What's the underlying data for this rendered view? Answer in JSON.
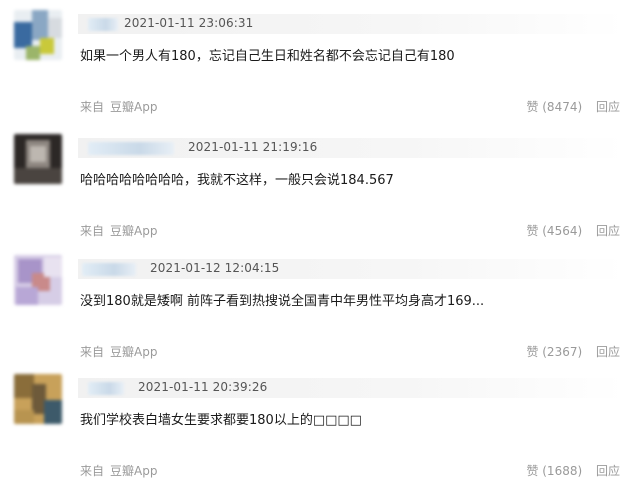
{
  "comments": [
    {
      "time": "2021-01-11 23:06:31",
      "content": "如果一个男人有180，忘记自己生日和姓名都不会忘记自己有180",
      "source_prefix": "来自",
      "source_app": "豆瓣App",
      "like_label": "赞 (8474)",
      "reply_label": "回应"
    },
    {
      "time": "2021-01-11 21:19:16",
      "content": "哈哈哈哈哈哈哈哈，我就不这样，一般只会说184.567",
      "source_prefix": "来自",
      "source_app": "豆瓣App",
      "like_label": "赞 (4564)",
      "reply_label": "回应"
    },
    {
      "time": "2021-01-12 12:04:15",
      "content": "没到180就是矮啊 前阵子看到热搜说全国青中年男性平均身高才169...",
      "source_prefix": "来自",
      "source_app": "豆瓣App",
      "like_label": "赞 (2367)",
      "reply_label": "回应"
    },
    {
      "time": "2021-01-11 20:39:26",
      "content": "我们学校表白墙女生要求都要180以上的□□□□",
      "source_prefix": "来自",
      "source_app": "豆瓣App",
      "like_label": "赞 (1688)",
      "reply_label": "回应"
    }
  ]
}
